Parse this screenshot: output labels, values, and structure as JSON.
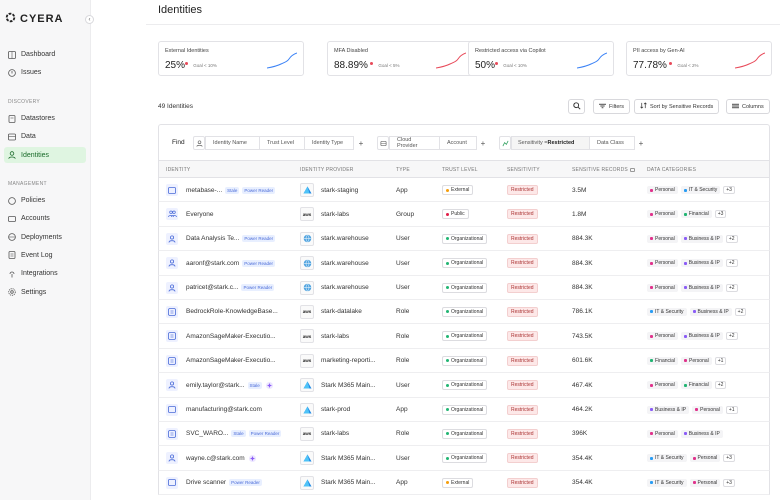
{
  "app": {
    "brand": "CYERA"
  },
  "sidebar": {
    "top_items": [
      {
        "label": "Dashboard",
        "icon": "dashboard-icon"
      },
      {
        "label": "Issues",
        "icon": "issues-icon"
      }
    ],
    "discovery_label": "DISCOVERY",
    "discovery_items": [
      {
        "label": "Datastores",
        "icon": "datastore-icon"
      },
      {
        "label": "Data",
        "icon": "data-icon"
      },
      {
        "label": "Identities",
        "icon": "identity-icon",
        "active": true
      }
    ],
    "management_label": "MANAGEMENT",
    "management_items": [
      {
        "label": "Policies",
        "icon": "policy-icon"
      },
      {
        "label": "Accounts",
        "icon": "accounts-icon"
      },
      {
        "label": "Deployments",
        "icon": "deployments-icon"
      },
      {
        "label": "Event Log",
        "icon": "eventlog-icon"
      },
      {
        "label": "Integrations",
        "icon": "integrations-icon"
      },
      {
        "label": "Settings",
        "icon": "settings-icon"
      }
    ]
  },
  "header": {
    "title": "Identities"
  },
  "cards": [
    {
      "title": "External Identities",
      "value": "25%",
      "goal": "Goal < 10%",
      "trend": "up",
      "color": "#3b82f6"
    },
    {
      "title": "MFA Disabled",
      "value": "88.89%",
      "goal": "Goal < 5%",
      "trend": "up",
      "color": "#e84a5a"
    },
    {
      "title": "Restricted access via Copilot",
      "value": "50%",
      "goal": "Goal < 10%",
      "trend": "up",
      "color": "#3b82f6"
    },
    {
      "title": "PII access by Gen-AI",
      "value": "77.78%",
      "goal": "Goal < 2%",
      "trend": "up",
      "color": "#e84a5a"
    }
  ],
  "toolbar": {
    "count": "49 Identities",
    "filters": "Filters",
    "sort": "Sort by Sensitive Records",
    "columns": "Columns"
  },
  "find": {
    "label": "Find",
    "group1": [
      "Identity Name",
      "Trust Level",
      "Identity Type"
    ],
    "group2": [
      "Cloud Provider",
      "Account"
    ],
    "group3_selected": "Sensitivity = Restricted",
    "group3_sensitivity_key": "Sensitivity = ",
    "group3_sensitivity_val": "Restricted",
    "group3": [
      "Data Class"
    ]
  },
  "table": {
    "headers": [
      "IDENTITY",
      "IDENTITY PROVIDER",
      "TYPE",
      "TRUST LEVEL",
      "SENSITIVITY",
      "SENSITIVE RECORDS",
      "DATA CATEGORIES"
    ],
    "rows": [
      {
        "name": "metabase-...",
        "tags": [
          "Stale",
          "Power Reader"
        ],
        "purple": false,
        "provider": "stark-staging",
        "prov": "azure",
        "type": "App",
        "trust": "External",
        "sens": "Restricted",
        "records": "3.5M",
        "cats": [
          [
            "Personal",
            "#e0338c"
          ],
          [
            "IT & Security",
            "#2a9df4"
          ]
        ],
        "more": "+3",
        "icon": "app"
      },
      {
        "name": "Everyone",
        "tags": [],
        "purple": false,
        "provider": "stark-labs",
        "prov": "aws",
        "type": "Group",
        "trust": "Public",
        "sens": "Restricted",
        "records": "1.8M",
        "cats": [
          [
            "Personal",
            "#e0338c"
          ],
          [
            "Financial",
            "#22b573"
          ]
        ],
        "more": "+3",
        "icon": "group"
      },
      {
        "name": "Data Analysis Te...",
        "tags": [
          "Power Reader"
        ],
        "purple": false,
        "provider": "stark.warehouse",
        "prov": "globe",
        "type": "User",
        "trust": "Organizational",
        "sens": "Restricted",
        "records": "884.3K",
        "cats": [
          [
            "Personal",
            "#e0338c"
          ],
          [
            "Business & IP",
            "#8b5cf6"
          ]
        ],
        "more": "+2",
        "icon": "user"
      },
      {
        "name": "aaronf@stark.com",
        "tags": [
          "Power Reader"
        ],
        "purple": false,
        "provider": "stark.warehouse",
        "prov": "globe",
        "type": "User",
        "trust": "Organizational",
        "sens": "Restricted",
        "records": "884.3K",
        "cats": [
          [
            "Personal",
            "#e0338c"
          ],
          [
            "Business & IP",
            "#8b5cf6"
          ]
        ],
        "more": "+2",
        "icon": "user"
      },
      {
        "name": "patricet@stark.c...",
        "tags": [
          "Power Reader"
        ],
        "purple": false,
        "provider": "stark.warehouse",
        "prov": "globe",
        "type": "User",
        "trust": "Organizational",
        "sens": "Restricted",
        "records": "884.3K",
        "cats": [
          [
            "Personal",
            "#e0338c"
          ],
          [
            "Business & IP",
            "#8b5cf6"
          ]
        ],
        "more": "+2",
        "icon": "user"
      },
      {
        "name": "BedrockRole-KnowledgeBase...",
        "tags": [],
        "purple": false,
        "provider": "stark-datalake",
        "prov": "aws",
        "type": "Role",
        "trust": "Organizational",
        "sens": "Restricted",
        "records": "786.1K",
        "cats": [
          [
            "IT & Security",
            "#2a9df4"
          ],
          [
            "Business & IP",
            "#8b5cf6"
          ]
        ],
        "more": "+2",
        "icon": "role"
      },
      {
        "name": "AmazonSageMaker-Executio...",
        "tags": [],
        "purple": false,
        "provider": "stark-labs",
        "prov": "aws",
        "type": "Role",
        "trust": "Organizational",
        "sens": "Restricted",
        "records": "743.5K",
        "cats": [
          [
            "Personal",
            "#e0338c"
          ],
          [
            "Business & IP",
            "#8b5cf6"
          ]
        ],
        "more": "+2",
        "icon": "role"
      },
      {
        "name": "AmazonSageMaker-Executio...",
        "tags": [],
        "purple": false,
        "provider": "marketing-reporti...",
        "prov": "aws",
        "type": "Role",
        "trust": "Organizational",
        "sens": "Restricted",
        "records": "601.6K",
        "cats": [
          [
            "Financial",
            "#22b573"
          ],
          [
            "Personal",
            "#e0338c"
          ]
        ],
        "more": "+1",
        "icon": "role"
      },
      {
        "name": "emily.taylor@stark...",
        "tags": [
          "Stale"
        ],
        "purple": true,
        "provider": "Stark M365 Main...",
        "prov": "azure",
        "type": "User",
        "trust": "Organizational",
        "sens": "Restricted",
        "records": "467.4K",
        "cats": [
          [
            "Personal",
            "#e0338c"
          ],
          [
            "Financial",
            "#22b573"
          ]
        ],
        "more": "+2",
        "icon": "user"
      },
      {
        "name": "manufacturing@stark.com",
        "tags": [],
        "purple": false,
        "provider": "stark-prod",
        "prov": "azure",
        "type": "App",
        "trust": "Organizational",
        "sens": "Restricted",
        "records": "464.2K",
        "cats": [
          [
            "Business & IP",
            "#8b5cf6"
          ],
          [
            "Personal",
            "#e0338c"
          ]
        ],
        "more": "+1",
        "icon": "app"
      },
      {
        "name": "SVC_WARO...",
        "tags": [
          "Stale",
          "Power Reader"
        ],
        "purple": false,
        "provider": "stark-labs",
        "prov": "aws",
        "type": "Role",
        "trust": "Organizational",
        "sens": "Restricted",
        "records": "396K",
        "cats": [
          [
            "Personal",
            "#e0338c"
          ],
          [
            "Business & IP",
            "#8b5cf6"
          ]
        ],
        "more": "",
        "icon": "role"
      },
      {
        "name": "wayne.c@stark.com",
        "tags": [],
        "purple": true,
        "provider": "Stark M365 Main...",
        "prov": "azure",
        "type": "User",
        "trust": "Organizational",
        "sens": "Restricted",
        "records": "354.4K",
        "cats": [
          [
            "IT & Security",
            "#2a9df4"
          ],
          [
            "Personal",
            "#e0338c"
          ]
        ],
        "more": "+3",
        "icon": "user"
      },
      {
        "name": "Drive scanner",
        "tags": [
          "Power Reader"
        ],
        "purple": false,
        "provider": "Stark M365 Main...",
        "prov": "azure",
        "type": "App",
        "trust": "External",
        "sens": "Restricted",
        "records": "354.4K",
        "cats": [
          [
            "IT & Security",
            "#2a9df4"
          ],
          [
            "Personal",
            "#e0338c"
          ]
        ],
        "more": "+3",
        "icon": "app"
      }
    ]
  },
  "colors": {
    "accent": "#1a6b2a",
    "restricted": "#a33",
    "external_dot": "#f59e0b",
    "public_dot": "#e11d48",
    "org_dot": "#22b573"
  }
}
